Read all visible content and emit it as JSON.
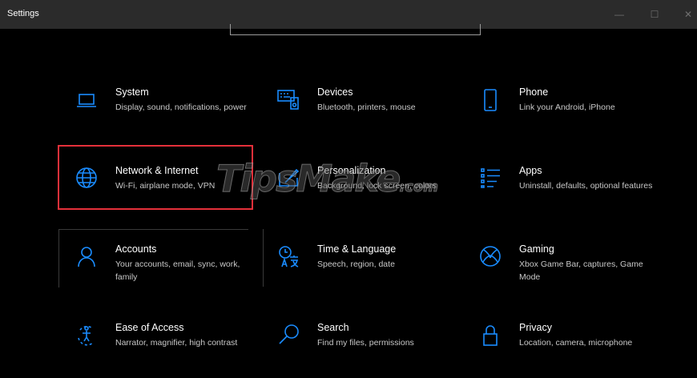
{
  "window": {
    "title": "Settings",
    "controls": {
      "minimize": "—",
      "maximize": "☐",
      "close": "✕"
    }
  },
  "categories": [
    {
      "title": "System",
      "description": "Display, sound, notifications, power",
      "icon": "laptop-icon"
    },
    {
      "title": "Devices",
      "description": "Bluetooth, printers, mouse",
      "icon": "devices-icon"
    },
    {
      "title": "Phone",
      "description": "Link your Android, iPhone",
      "icon": "phone-icon"
    },
    {
      "title": "Network & Internet",
      "description": "Wi-Fi, airplane mode, VPN",
      "icon": "globe-icon"
    },
    {
      "title": "Personalization",
      "description": "Background, lock screen, colors",
      "icon": "paintbrush-icon"
    },
    {
      "title": "Apps",
      "description": "Uninstall, defaults, optional features",
      "icon": "apps-list-icon"
    },
    {
      "title": "Accounts",
      "description": "Your accounts, email, sync, work, family",
      "icon": "person-icon"
    },
    {
      "title": "Time & Language",
      "description": "Speech, region, date",
      "icon": "time-language-icon"
    },
    {
      "title": "Gaming",
      "description": "Xbox Game Bar, captures, Game Mode",
      "icon": "xbox-icon"
    },
    {
      "title": "Ease of Access",
      "description": "Narrator, magnifier, high contrast",
      "icon": "ease-of-access-icon"
    },
    {
      "title": "Search",
      "description": "Find my files, permissions",
      "icon": "search-icon"
    },
    {
      "title": "Privacy",
      "description": "Location, camera, microphone",
      "icon": "lock-icon"
    }
  ],
  "watermark": {
    "brand": "TipsMake",
    "suffix": ".com"
  },
  "colors": {
    "accent": "#0a84ff",
    "highlight_border": "#e5303a",
    "background": "#000000",
    "titlebar": "#2b2b2b"
  }
}
